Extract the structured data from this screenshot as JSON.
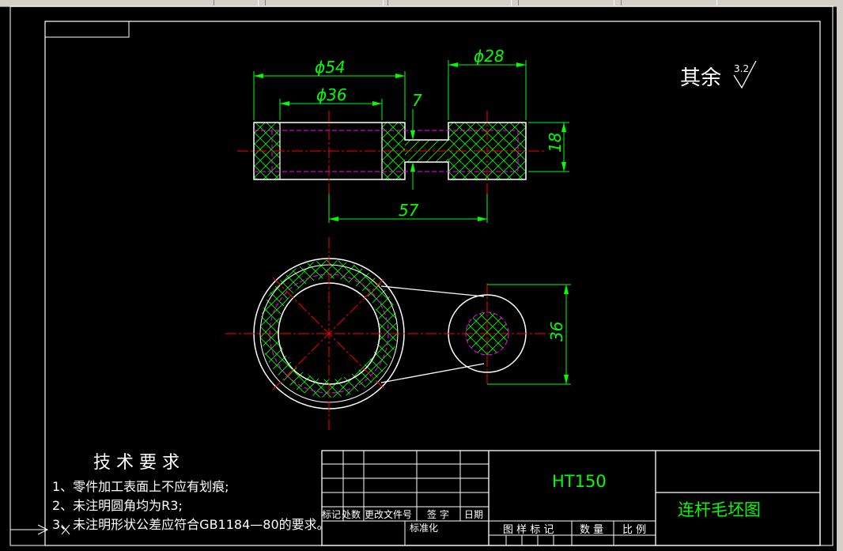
{
  "drawing": {
    "roughness_prefix": "其余",
    "roughness_value": "3.2",
    "dimensions": {
      "d54": "ϕ54",
      "d36": "ϕ36",
      "d28": "ϕ28",
      "w7": "7",
      "h18": "18",
      "c57": "57",
      "h36": "36"
    }
  },
  "tech_requirements": {
    "title": "技 术 要 求",
    "items": [
      "1、零件加工表面上不应有划痕;",
      "2、未注明圆角均为R3;",
      "3、未注明形状公差应符合GB1184—80的要求。"
    ]
  },
  "title_block": {
    "material": "HT150",
    "drawing_name": "连杆毛坯图",
    "row_labels": [
      "标记",
      "处数",
      "更改文件号",
      "签 字",
      "日期"
    ],
    "standardization": "标准化",
    "stage_mark": "图 样 标 记",
    "quantity": "数 量",
    "scale": "比 例"
  },
  "colors": {
    "background": "#000000",
    "outline": "#ffffff",
    "dimension": "#00ff00",
    "centerline": "#ff0000",
    "hidden": "#ff00ff",
    "toolbar": "#d4d0c8"
  }
}
